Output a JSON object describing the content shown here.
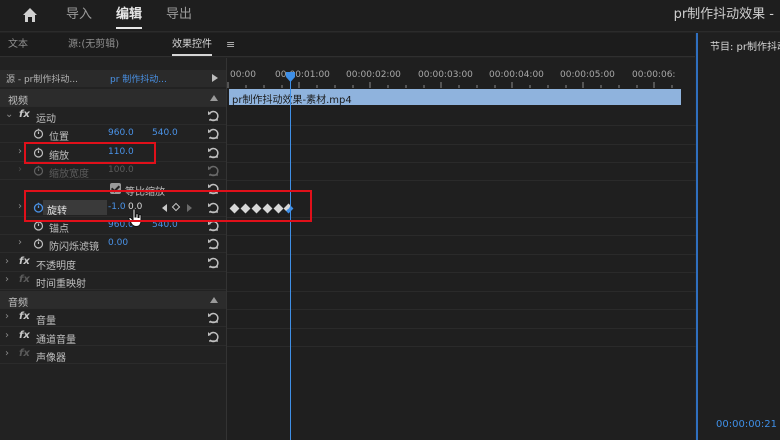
{
  "topbar": {
    "nav": [
      "导入",
      "编辑",
      "导出"
    ],
    "active": "编辑",
    "app_title": "pr制作抖动效果 -"
  },
  "tabs": {
    "items": [
      "文本",
      "源:(无剪辑)",
      "效果控件"
    ],
    "active": "效果控件",
    "menu_icon": "≡"
  },
  "program_monitor": {
    "title": "节目: pr制作抖动",
    "timecode": "00:00:00:21"
  },
  "effect_controls": {
    "source_label": "源 - pr制作抖动...",
    "sequence_label": "pr 制作抖动...",
    "video_header": "视频",
    "motion": {
      "label": "运动",
      "position": {
        "label": "位置",
        "x": "960.0",
        "y": "540.0"
      },
      "scale": {
        "label": "缩放",
        "value": "110.0"
      },
      "scale_width": {
        "label": "缩放宽度",
        "value": "100.0"
      },
      "uniform_scale": {
        "label": "等比缩放"
      },
      "rotation": {
        "label": "旋转",
        "value": "-1.0",
        "value_suffix": "0.0"
      },
      "anchor": {
        "label": "锚点",
        "x": "960.0",
        "y": "540.0"
      },
      "anti_flicker": {
        "label": "防闪烁滤镜",
        "value": "0.00"
      }
    },
    "opacity": {
      "label": "不透明度"
    },
    "time_remap": {
      "label": "时间重映射"
    },
    "audio_header": "音频",
    "volume": {
      "label": "音量"
    },
    "channel_volume": {
      "label": "通道音量"
    },
    "panner": {
      "label": "声像器"
    }
  },
  "timeline": {
    "ticks": [
      "00:00",
      "00:00:01:00",
      "00:00:02:00",
      "00:00:03:00",
      "00:00:04:00",
      "00:00:05:00",
      "00:00:06:"
    ],
    "clip_name": "pr制作抖动效果-素材.mp4",
    "keyframe_count": 6
  },
  "colors": {
    "accent_blue": "#3f8fe6",
    "value_blue": "#4a93e8",
    "clip_blue": "#8fb3dd",
    "highlight_red": "#e0101a"
  }
}
